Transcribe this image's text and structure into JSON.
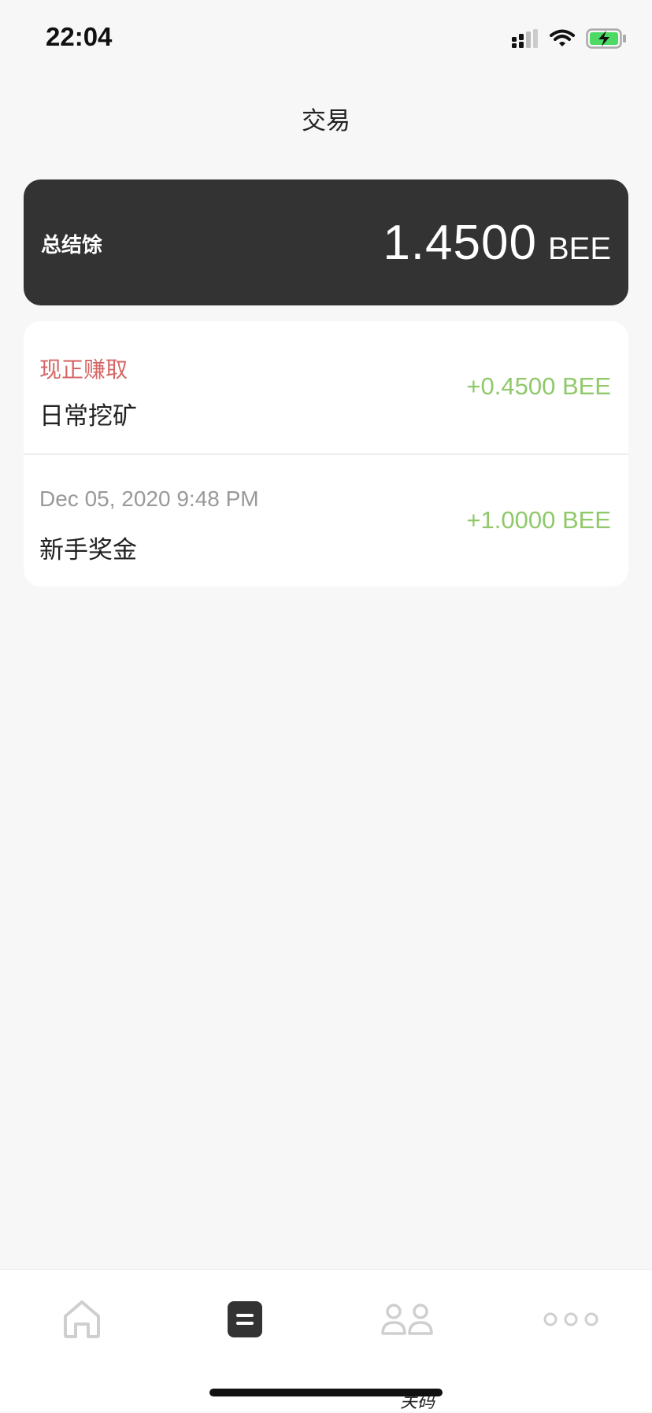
{
  "status_bar": {
    "time": "22:04"
  },
  "header": {
    "title": "交易"
  },
  "balance": {
    "label": "总结馀",
    "amount": "1.4500",
    "unit": "BEE"
  },
  "transactions": [
    {
      "line1": "现正赚取",
      "line2": "日常挖矿",
      "amount": "+0.4500 BEE"
    },
    {
      "line1": "Dec 05, 2020 9:48 PM",
      "line2": "新手奖金",
      "amount": "+1.0000 BEE"
    }
  ],
  "tab_bar": {
    "tabs": [
      {
        "icon": "home-icon",
        "active": false
      },
      {
        "icon": "transactions-icon",
        "active": true
      },
      {
        "icon": "team-icon",
        "active": false
      },
      {
        "icon": "more-icon",
        "active": false
      }
    ],
    "caption": "关码"
  },
  "colors": {
    "card_dark": "#333333",
    "positive": "#8fc96a",
    "status_red": "#d66666",
    "background": "#f7f7f7"
  }
}
